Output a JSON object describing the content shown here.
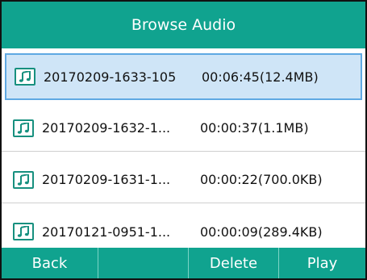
{
  "title": "Browse Audio",
  "files": [
    {
      "name": "20170209-1633-105",
      "info": "00:06:45(12.4MB)",
      "icon": "music-note-icon",
      "selected": true
    },
    {
      "name": "20170209-1632-1...",
      "info": "00:00:37(1.1MB)",
      "icon": "music-note-icon",
      "selected": false
    },
    {
      "name": "20170209-1631-1...",
      "info": "00:00:22(700.0KB)",
      "icon": "music-note-icon",
      "selected": false
    },
    {
      "name": "20170121-0951-1...",
      "info": "00:00:09(289.4KB)",
      "icon": "music-note-icon",
      "selected": false
    }
  ],
  "softkeys": {
    "back": "Back",
    "empty": "",
    "delete": "Delete",
    "play": "Play"
  },
  "colors": {
    "accent": "#10a38f",
    "selection_fill": "#cfe5f7",
    "selection_border": "#5fa9e3",
    "icon": "#17907f"
  }
}
